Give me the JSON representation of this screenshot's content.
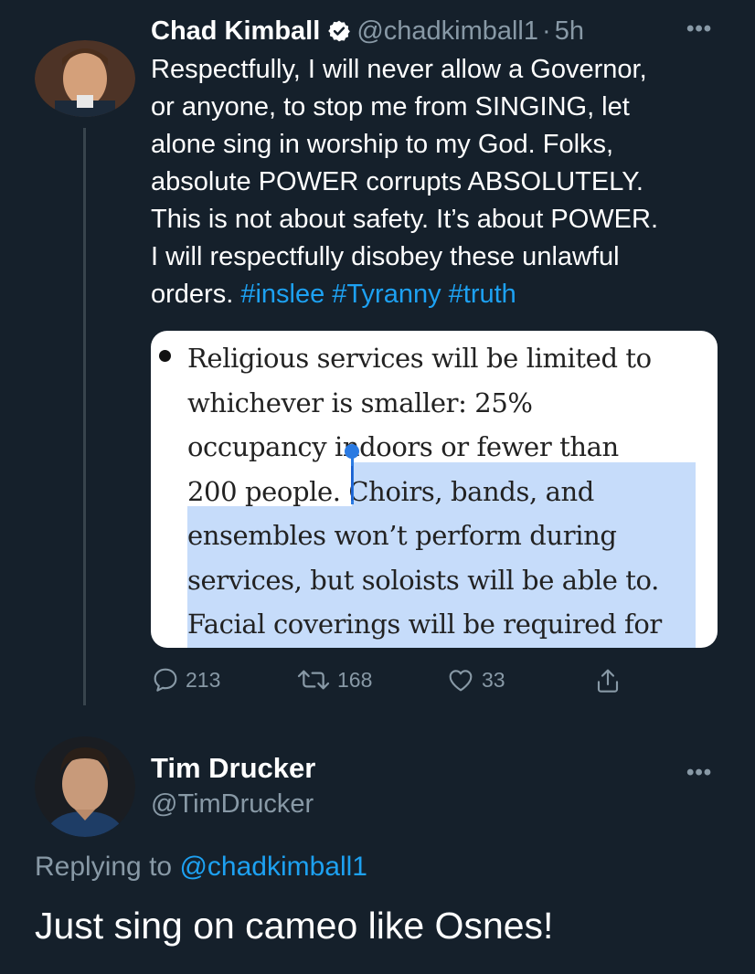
{
  "tweet1": {
    "name": "Chad Kimball",
    "handle": "@chadkimball1",
    "separator": "·",
    "time": "5h",
    "more_icon": "more-horizontal-icon",
    "verified_icon": "verified-badge-icon",
    "text_lines": [
      "Respectfully, I will never allow a Governor,",
      "or anyone, to stop me from SINGING, let",
      "alone sing in worship to my God. Folks,",
      "absolute POWER corrupts ABSOLUTELY.",
      "This is not about safety. It’s about POWER.",
      "I will respectfully disobey these unlawful",
      "orders. "
    ],
    "hashtags": [
      "#inslee",
      "#Tyranny",
      "#truth"
    ],
    "media_lines": [
      "Religious services will be limited to",
      "whichever is smaller: 25%",
      "occupancy indoors or fewer than",
      "200 people. Choirs, bands, and",
      "ensembles won’t perform during",
      "services, but soloists will be able to.",
      "Facial coverings will be required for"
    ],
    "actions": {
      "reply_count": "213",
      "retweet_count": "168",
      "like_count": "33",
      "icons": [
        "reply-icon",
        "retweet-icon",
        "like-icon",
        "share-icon"
      ]
    }
  },
  "tweet2": {
    "name": "Tim Drucker",
    "handle": "@TimDrucker",
    "replying_prefix": "Replying to ",
    "replying_handle": "@chadkimball1",
    "text": "Just sing on cameo like Osnes!"
  },
  "colors": {
    "background": "#15202b",
    "text": "#ffffff",
    "secondary": "#8899a6",
    "accent": "#1da1f2",
    "selection": "#c6dcfa"
  }
}
